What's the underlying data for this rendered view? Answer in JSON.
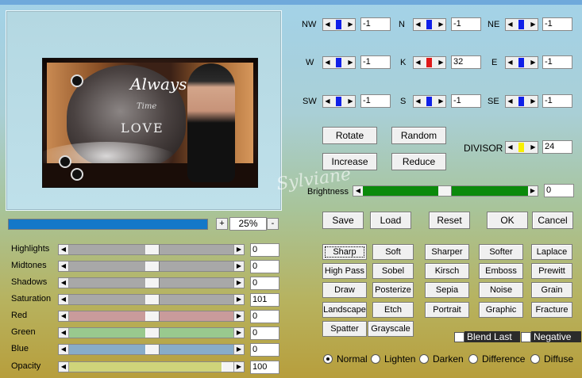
{
  "preview": {
    "image_text": [
      "Always",
      "Time",
      "LOVE",
      "Sylviane"
    ]
  },
  "zoom": {
    "value": "25%",
    "plus": "+",
    "minus": "-",
    "progress": 1.0
  },
  "sliders": [
    {
      "label": "Highlights",
      "value": "0",
      "color": "#a8a8a8",
      "level": 0.5
    },
    {
      "label": "Midtones",
      "value": "0",
      "color": "#a8a8a8",
      "level": 0.5
    },
    {
      "label": "Shadows",
      "value": "0",
      "color": "#a8a8a8",
      "level": 0.5
    },
    {
      "label": "Saturation",
      "value": "101",
      "color": "#a8a8a8",
      "level": 0.5
    },
    {
      "label": "Red",
      "value": "0",
      "color": "#c99b9b",
      "level": 0.5
    },
    {
      "label": "Green",
      "value": "0",
      "color": "#99c98e",
      "level": 0.5
    },
    {
      "label": "Blue",
      "value": "0",
      "color": "#88acc8",
      "level": 0.5
    },
    {
      "label": "Opacity",
      "value": "100",
      "color": "#cfd47a",
      "level": 1.0
    }
  ],
  "matrix": {
    "NW": {
      "label": "NW",
      "value": "-1"
    },
    "N": {
      "label": "N",
      "value": "-1"
    },
    "NE": {
      "label": "NE",
      "value": "-1"
    },
    "W": {
      "label": "W",
      "value": "-1"
    },
    "K": {
      "label": "K",
      "value": "32"
    },
    "E": {
      "label": "E",
      "value": "-1"
    },
    "SW": {
      "label": "SW",
      "value": "-1"
    },
    "S": {
      "label": "S",
      "value": "-1"
    },
    "SE": {
      "label": "SE",
      "value": "-1"
    }
  },
  "buttons": {
    "rotate": "Rotate",
    "random": "Random",
    "increase": "Increase",
    "reduce": "Reduce",
    "save": "Save",
    "load": "Load",
    "reset": "Reset",
    "ok": "OK",
    "cancel": "Cancel"
  },
  "divisor": {
    "label": "DIVISOR",
    "value": "24"
  },
  "brightness": {
    "label": "Brightness",
    "value": "0"
  },
  "filters": [
    "Sharp",
    "Soft",
    "Sharper",
    "Softer",
    "Laplace",
    "High Pass",
    "Sobel",
    "Kirsch",
    "Emboss",
    "Prewitt",
    "Draw",
    "Posterize",
    "Sepia",
    "Noise",
    "Grain",
    "Landscape",
    "Etch",
    "Portrait",
    "Graphic",
    "Fracture",
    "Spatter",
    "Grayscale"
  ],
  "checkboxes": {
    "blend_last": "Blend Last",
    "negative": "Negative"
  },
  "blend_modes": {
    "options": [
      "Normal",
      "Lighten",
      "Darken",
      "Difference",
      "Diffuse"
    ],
    "selected": "Normal"
  }
}
